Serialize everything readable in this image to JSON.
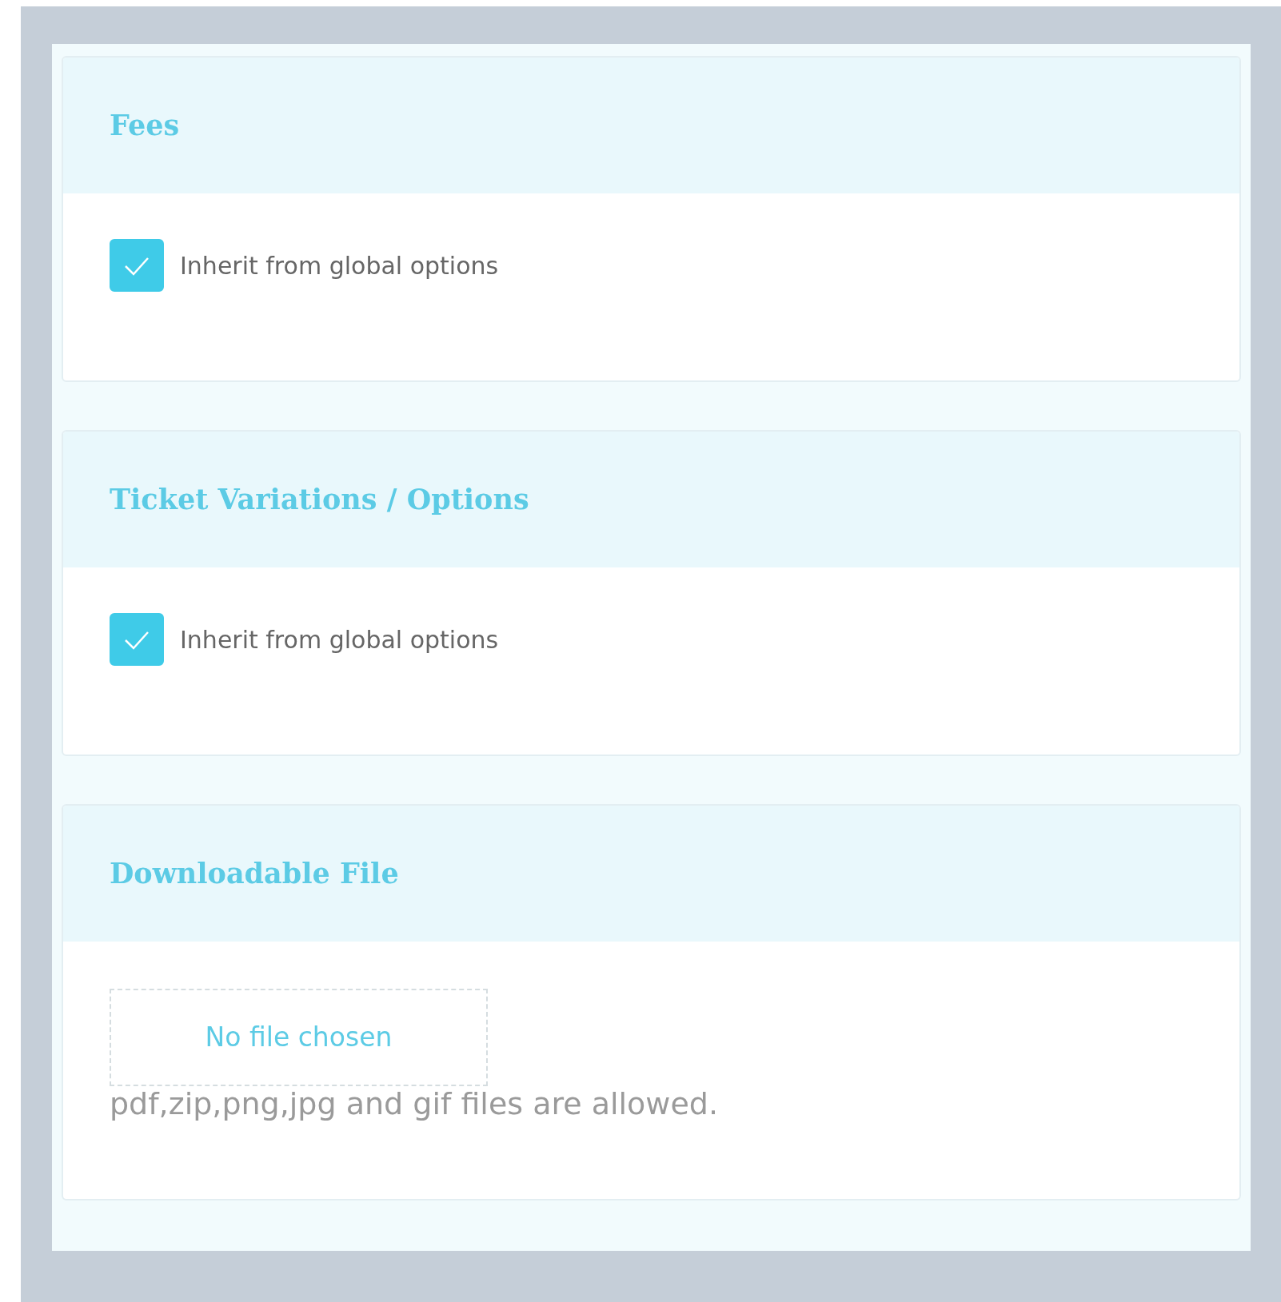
{
  "sections": [
    {
      "title": "Fees",
      "kind": "checkbox",
      "label": "Inherit from global options",
      "checked": true
    },
    {
      "title": "Ticket Variations / Options",
      "kind": "checkbox",
      "label": "Inherit from global options",
      "checked": true
    },
    {
      "title": "Downloadable File",
      "kind": "file",
      "file_label": "No file chosen",
      "help": "pdf,zip,png,jpg and gif files are allowed."
    }
  ]
}
